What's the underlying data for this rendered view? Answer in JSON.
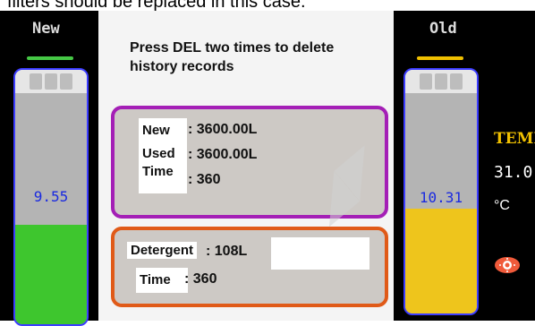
{
  "caption": "filters should be replaced in this case.",
  "left_gauge": {
    "title": "New",
    "value": "9.55",
    "fill_fraction": 0.39,
    "fill_color": "#3ec62e",
    "cap_color": "#46c846"
  },
  "right_gauge": {
    "title": "Old",
    "value": "10.31",
    "fill_fraction": 0.43,
    "fill_color": "#eec51c",
    "cap_color": "#f0c000"
  },
  "message": {
    "line1": "Press DEL two times to delete",
    "line2": "history records"
  },
  "stats_box": {
    "new_label": "New",
    "new_value": ": 3600.00L",
    "used_label": "Used",
    "used_value": ": 3600.00L",
    "time_label": "Time",
    "time_value": ": 360"
  },
  "detergent_box": {
    "detergent_label": "Detergent",
    "detergent_value": ": 108L",
    "time_label": "Time",
    "time_value": ": 360"
  },
  "temperature": {
    "label": "TEMP",
    "value": "31.0",
    "unit": "°C"
  },
  "icons": {
    "alarm": "gear-icon",
    "watermark": "watermark-logo"
  }
}
